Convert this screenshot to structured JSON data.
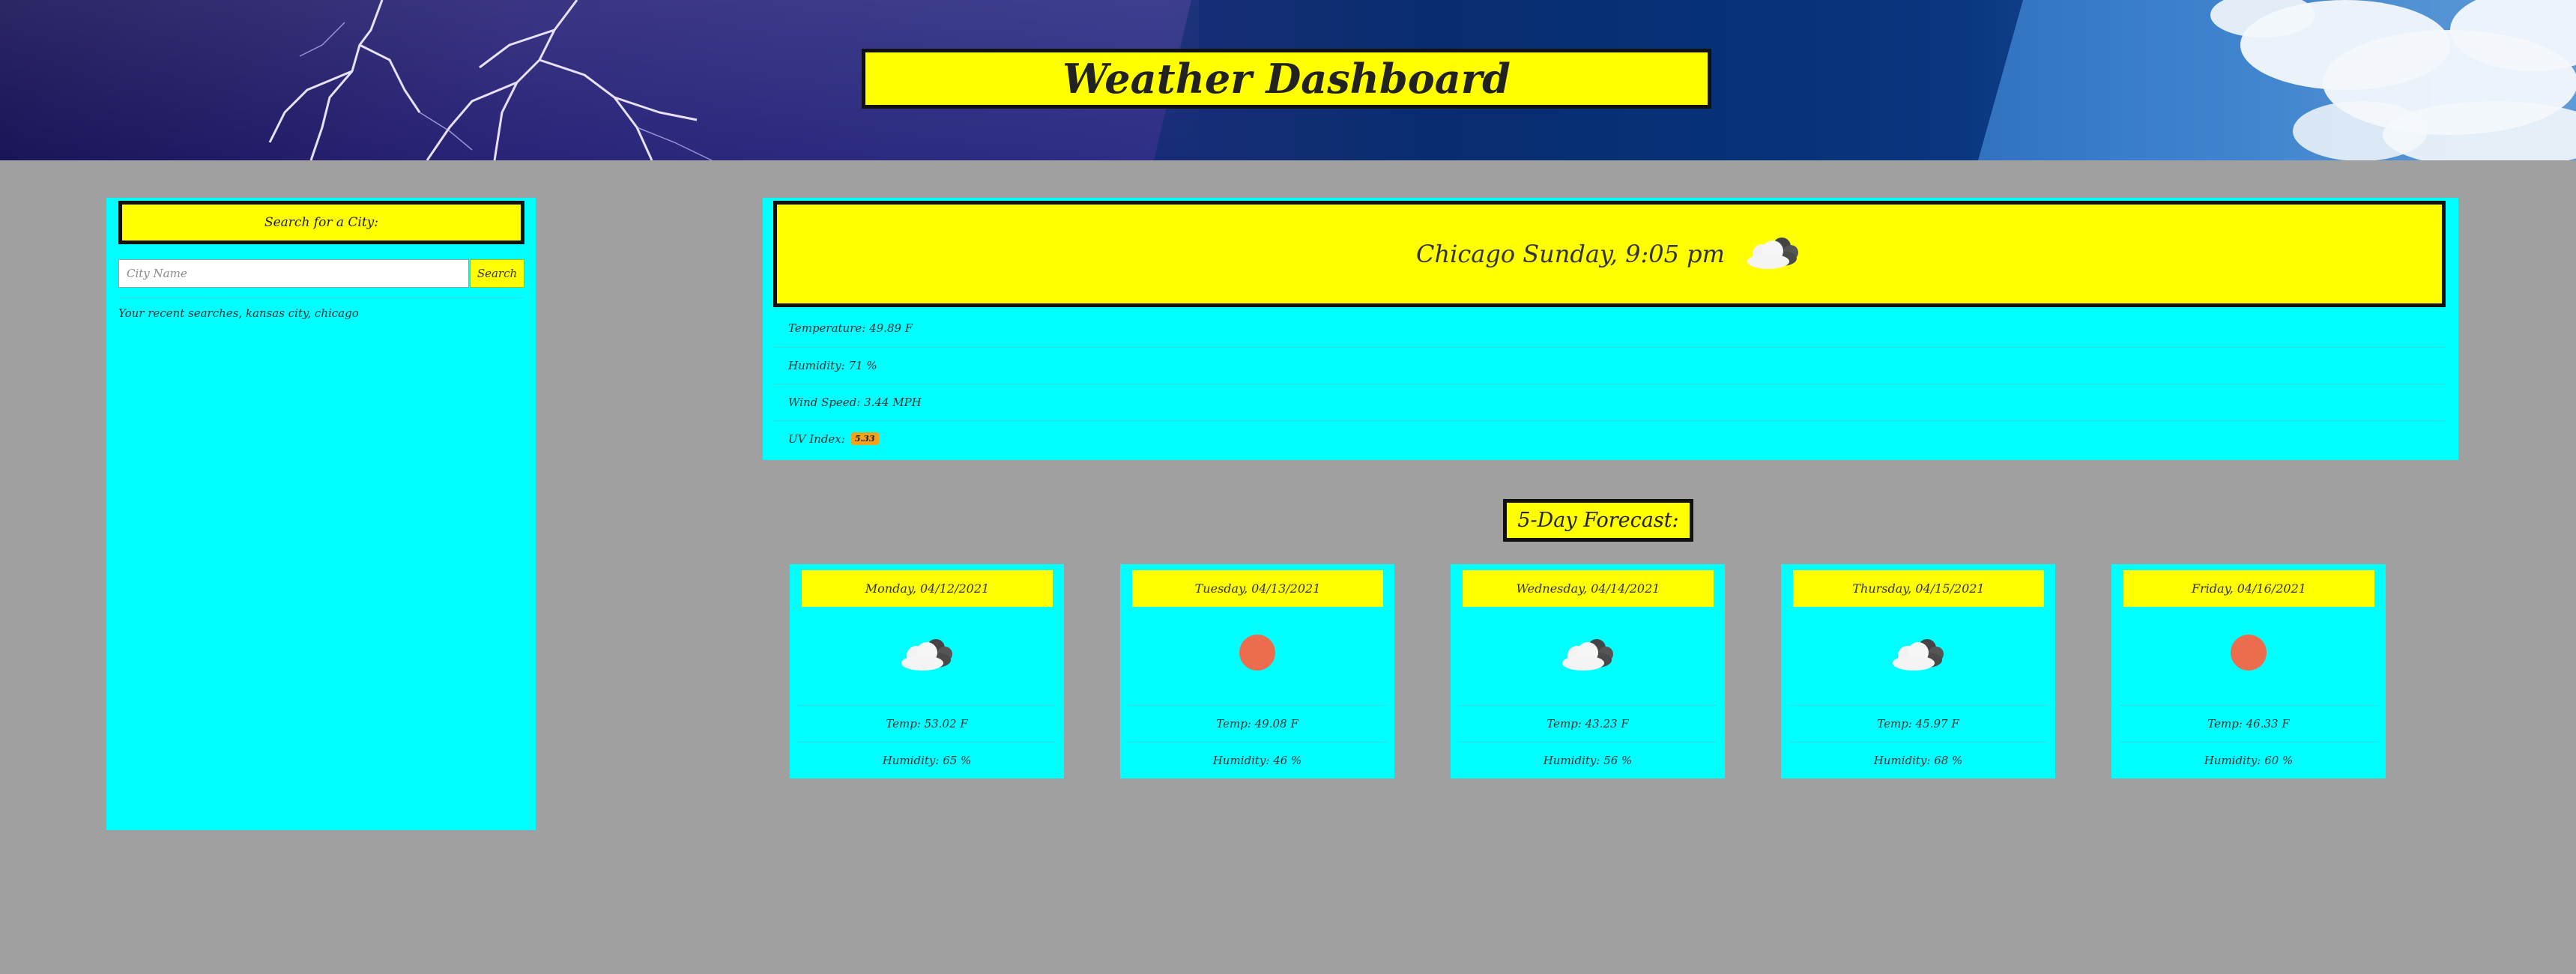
{
  "header": {
    "title": "Weather Dashboard"
  },
  "sidebar": {
    "heading": "Search for a City:",
    "input_placeholder": "City Name",
    "input_value": "",
    "search_label": "Search",
    "recent_text": "Your recent searches, kansas city, chicago"
  },
  "current": {
    "heading": "Chicago Sunday, 9:05 pm",
    "icon": "clouds-icon",
    "temperature": "Temperature: 49.89 F",
    "humidity": "Humidity: 71 %",
    "wind": "Wind Speed: 3.44 MPH",
    "uv_label": "UV Index:",
    "uv_value": "5.33",
    "uv_color": "#f4a21a"
  },
  "forecast": {
    "title": "5-Day Forecast:",
    "days": [
      {
        "date": "Monday, 04/12/2021",
        "icon": "clouds-icon",
        "temp": "Temp: 53.02 F",
        "humidity": "Humidity: 65 %"
      },
      {
        "date": "Tuesday, 04/13/2021",
        "icon": "sun-icon",
        "temp": "Temp: 49.08 F",
        "humidity": "Humidity: 46 %"
      },
      {
        "date": "Wednesday, 04/14/2021",
        "icon": "clouds-icon",
        "temp": "Temp: 43.23 F",
        "humidity": "Humidity: 56 %"
      },
      {
        "date": "Thursday, 04/15/2021",
        "icon": "clouds-icon",
        "temp": "Temp: 45.97 F",
        "humidity": "Humidity: 68 %"
      },
      {
        "date": "Friday, 04/16/2021",
        "icon": "sun-icon",
        "temp": "Temp: 46.33 F",
        "humidity": "Humidity: 60 %"
      }
    ]
  },
  "colors": {
    "accent_yellow": "#ffff00",
    "panel_cyan": "#00ffff",
    "page_gray": "#a0a0a0",
    "sun": "#ec6d4e"
  }
}
